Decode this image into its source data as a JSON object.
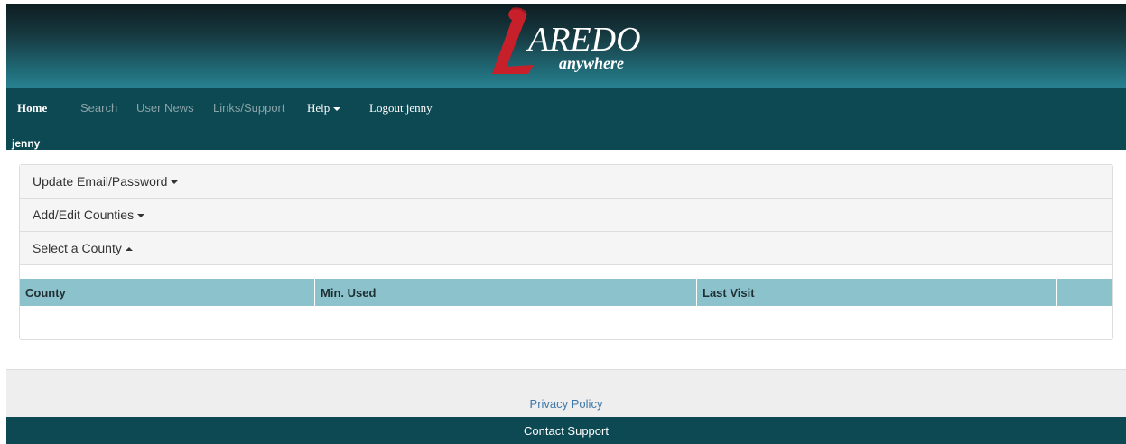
{
  "header": {
    "logo_text": "AREDO",
    "logo_subtext": "anywhere"
  },
  "nav": {
    "home": "Home",
    "search": "Search",
    "user_news": "User News",
    "links_support": "Links/Support",
    "help": "Help",
    "logout": "Logout jenny"
  },
  "user": {
    "name": "jenny"
  },
  "panels": {
    "update_email": "Update Email/Password",
    "add_edit_counties": "Add/Edit Counties",
    "select_county": "Select a County"
  },
  "table": {
    "columns": [
      "County",
      "Min. Used",
      "Last Visit",
      ""
    ],
    "rows": []
  },
  "footer": {
    "privacy": "Privacy Policy",
    "contact": "Contact Support"
  },
  "colors": {
    "nav_bg": "#0d4953",
    "table_header": "#8bc2cc",
    "logo_red": "#c8202a"
  }
}
